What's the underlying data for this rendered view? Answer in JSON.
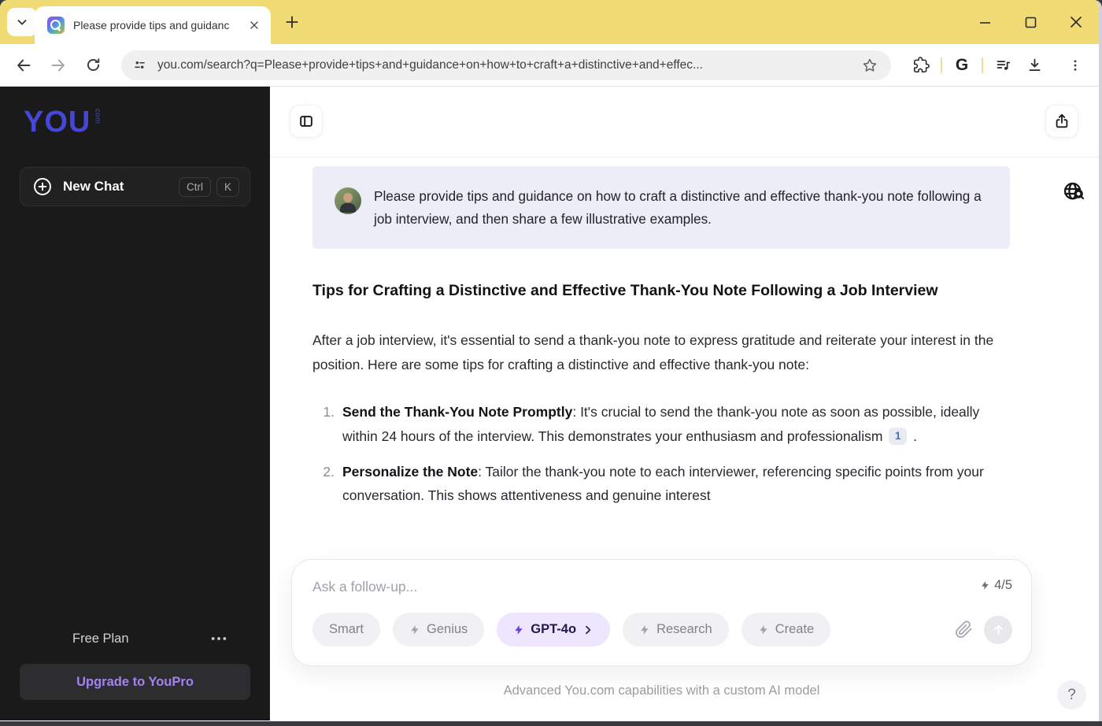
{
  "browser": {
    "tab_title": "Please provide tips and guidanc",
    "url": "you.com/search?q=Please+provide+tips+and+guidance+on+how+to+craft+a+distinctive+and+effec...",
    "toolbar": {
      "google_label": "G"
    }
  },
  "sidebar": {
    "logo_text": "YOU",
    "logo_suffix": "com",
    "new_chat_label": "New Chat",
    "shortcut_ctrl": "Ctrl",
    "shortcut_k": "K",
    "plan_label": "Free Plan",
    "upgrade_label": "Upgrade to YouPro"
  },
  "chat": {
    "user_query": "Please provide tips and guidance on how to craft a distinctive and effective thank-you note following a job interview, and then share a few illustrative examples.",
    "heading": "Tips for Crafting a Distinctive and Effective Thank-You Note Following a Job Interview",
    "intro": "After a job interview, it's essential to send a thank-you note to express gratitude and reiterate your interest in the position. Here are some tips for crafting a distinctive and effective thank-you note:",
    "list": {
      "0": {
        "num": "1.",
        "bold": "Send the Thank-You Note Promptly",
        "text": ": It's crucial to send the thank-you note as soon as possible, ideally within 24 hours of the interview. This demonstrates your enthusiasm and professionalism ",
        "citation": "1",
        "after": " ."
      },
      "1": {
        "num": "2.",
        "bold": "Personalize the Note",
        "text": ": Tailor the thank-you note to each interviewer, referencing specific points from your conversation. This shows attentiveness and genuine interest"
      }
    }
  },
  "composer": {
    "placeholder": "Ask a follow-up...",
    "quota": "4/5",
    "modes": {
      "0": {
        "label": "Smart"
      },
      "1": {
        "label": "Genius"
      },
      "2": {
        "label": "GPT-4o"
      },
      "3": {
        "label": "Research"
      },
      "4": {
        "label": "Create"
      }
    },
    "footnote": "Advanced You.com capabilities with a custom AI model",
    "help_label": "?"
  },
  "colors": {
    "titlebar_yellow": "#F1DB74",
    "sidebar_dark": "#1A1A1A",
    "logo_blue": "#4647D8",
    "upgrade_purple": "#A482F2",
    "query_bubble": "#EDEDF8",
    "active_pill_bg": "#EDE6FC",
    "active_bolt_purple": "#6C3BEE",
    "citation_blue": "#3F6DCE"
  }
}
